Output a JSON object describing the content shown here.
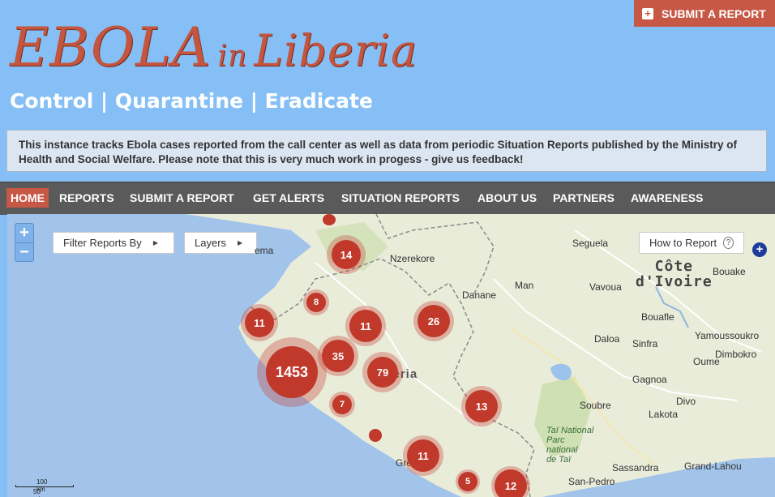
{
  "header": {
    "title_part1": "EBOLA",
    "title_part2": "in",
    "title_part3": "Liberia",
    "tagline": "Control | Quarantine | Eradicate",
    "submit_button": "SUBMIT A REPORT"
  },
  "notice": "This instance tracks Ebola cases reported from the call center as well as data from periodic Situation Reports published by the Ministry of Health and Social Welfare. Please note that this is very much work in progess - give us feedback!",
  "nav": {
    "items": [
      {
        "label": "HOME",
        "active": true
      },
      {
        "label": "REPORTS"
      },
      {
        "label": "SUBMIT A REPORT"
      },
      {
        "label": "GET ALERTS"
      },
      {
        "label": "SITUATION REPORTS"
      },
      {
        "label": "ABOUT US"
      },
      {
        "label": "PARTNERS"
      },
      {
        "label": "AWARENESS"
      }
    ]
  },
  "map": {
    "zoom_in": "+",
    "zoom_out": "−",
    "filter_label": "Filter Reports By",
    "layers_label": "Layers",
    "howto_label": "How to Report",
    "help_icon": "?",
    "side_plus": "+",
    "clusters": [
      {
        "id": "c14",
        "count": "14"
      },
      {
        "id": "c8",
        "count": "8"
      },
      {
        "id": "c11a",
        "count": "11"
      },
      {
        "id": "c11b",
        "count": "11"
      },
      {
        "id": "c26",
        "count": "26"
      },
      {
        "id": "c1453",
        "count": "1453"
      },
      {
        "id": "c35",
        "count": "35"
      },
      {
        "id": "c79",
        "count": "79"
      },
      {
        "id": "c7",
        "count": "7"
      },
      {
        "id": "c13",
        "count": "13"
      },
      {
        "id": "c11c",
        "count": "11"
      },
      {
        "id": "c5",
        "count": "5"
      },
      {
        "id": "c12",
        "count": "12"
      }
    ],
    "places": {
      "ema": "ema",
      "seguela": "Seguela",
      "nzerekore": "Nzerekore",
      "cote1": "Côte",
      "cote2": "d'Ivoire",
      "bouake": "Bouake",
      "man": "Man",
      "vavoua": "Vavoua",
      "danane": "Danane",
      "bouafle": "Bouafle",
      "yamoussoukro": "Yamoussoukro",
      "daloa": "Daloa",
      "sinfra": "Sinfra",
      "dimbokro": "Dimbokro",
      "oume": "Oume",
      "liberia": "Liberia",
      "gagnoa": "Gagnoa",
      "soubre": "Soubre",
      "divo": "Divo",
      "lakota": "Lakota",
      "tai": "Taï National",
      "park1": "Parc",
      "park2": "national",
      "park3": "de Taï",
      "green": "Green",
      "sassandra": "Sassandra",
      "grandlahou": "Grand-Lahou",
      "sanpedro": "San-Pedro"
    },
    "scale": {
      "km": "100 km",
      "mi": "50 mi"
    }
  }
}
